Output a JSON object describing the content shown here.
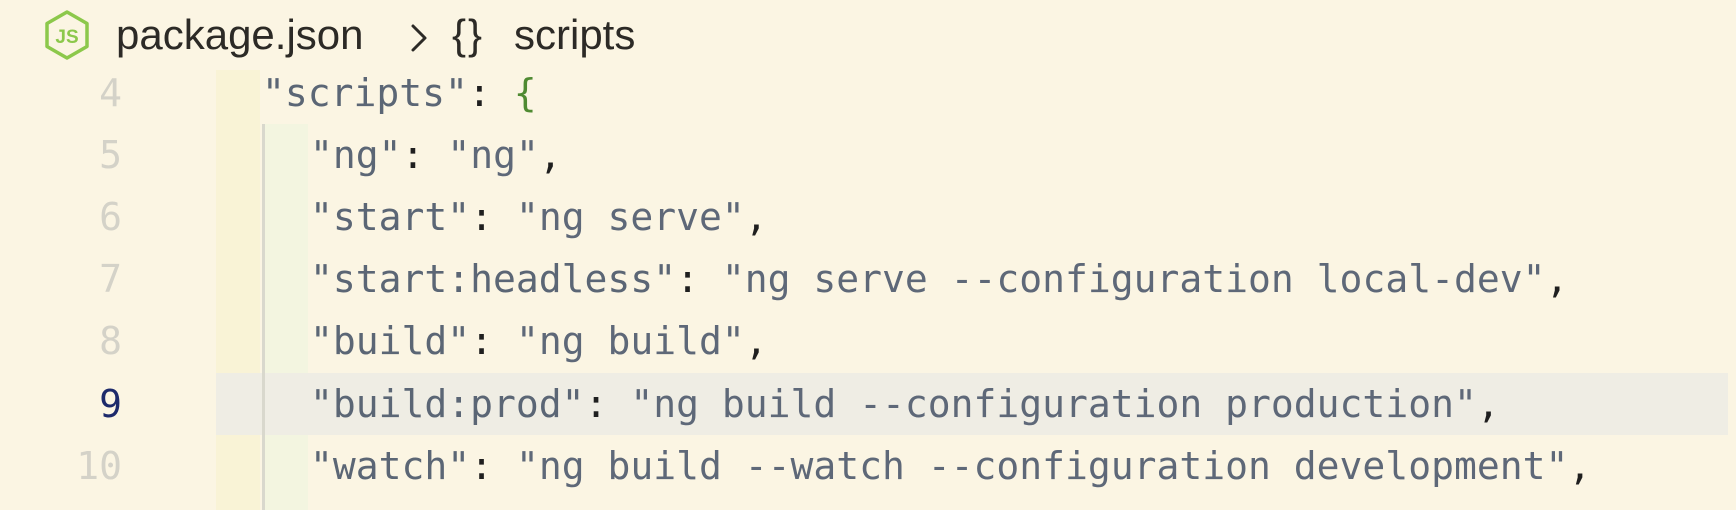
{
  "breadcrumb": {
    "file_icon": "nodejs-icon",
    "file_name": "package.json",
    "separator_icon": "chevron-right-icon",
    "symbol_glyph": "{}",
    "symbol_name": "scripts"
  },
  "editor": {
    "active_line": 9,
    "lines": [
      {
        "number": "4",
        "key": "scripts",
        "value": null,
        "trail": "",
        "opens_brace": "{"
      },
      {
        "number": "5",
        "key": "ng",
        "value": "ng",
        "trail": ","
      },
      {
        "number": "6",
        "key": "start",
        "value": "ng serve",
        "trail": ","
      },
      {
        "number": "7",
        "key": "start:headless",
        "value": "ng serve --configuration local-dev",
        "trail": ","
      },
      {
        "number": "8",
        "key": "build",
        "value": "ng build",
        "trail": ","
      },
      {
        "number": "9",
        "key": "build:prod",
        "value": "ng build --configuration production",
        "trail": ","
      },
      {
        "number": "10",
        "key": "watch",
        "value": "ng build --watch --configuration development",
        "trail": ","
      }
    ]
  },
  "colors": {
    "background": "#fbf5e3",
    "current_line": "#efede4",
    "brace": "#4f8a32",
    "node_icon": "#8cc84b",
    "active_line_number": "#1d2a6b"
  }
}
